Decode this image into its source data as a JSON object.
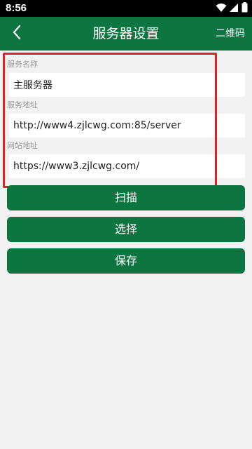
{
  "status_bar": {
    "time": "8:56"
  },
  "app_bar": {
    "title": "服务器设置",
    "right_action": "二维码"
  },
  "form": {
    "fields": [
      {
        "label": "服务名称",
        "value": "主服务器"
      },
      {
        "label": "服务地址",
        "value": "http://www4.zjlcwg.com:85/server"
      },
      {
        "label": "网站地址",
        "value": "https://www3.zjlcwg.com/"
      }
    ]
  },
  "buttons": {
    "scan": "扫描",
    "select": "选择",
    "save": "保存"
  },
  "colors": {
    "primary": "#0c7540",
    "status_bar": "#000000",
    "background": "#f2f2f2",
    "highlight": "#e02020"
  },
  "icons": {
    "back": "chevron-left-icon",
    "wifi": "wifi-icon",
    "signal": "signal-icon",
    "battery": "battery-icon"
  }
}
